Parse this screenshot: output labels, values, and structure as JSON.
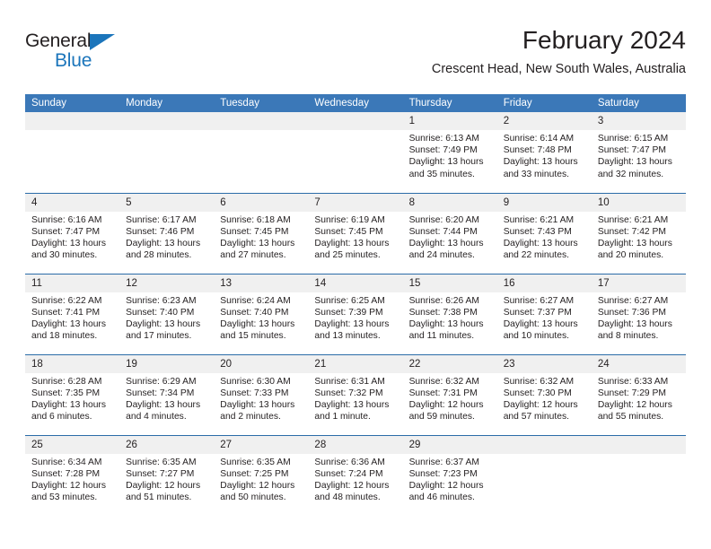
{
  "brand": {
    "name_top": "General",
    "name_bottom": "Blue",
    "triangle_color": "#1b75bb"
  },
  "header": {
    "title": "February 2024",
    "subtitle": "Crescent Head, New South Wales, Australia"
  },
  "colors": {
    "header_blue": "#3b78b8",
    "row_line_blue": "#2b6ca8",
    "daynum_band": "#f0f0f0",
    "text": "#231f20",
    "brand_blue": "#1b75bb"
  },
  "weekdays": [
    "Sunday",
    "Monday",
    "Tuesday",
    "Wednesday",
    "Thursday",
    "Friday",
    "Saturday"
  ],
  "weeks": [
    [
      {
        "day": "",
        "empty": true
      },
      {
        "day": "",
        "empty": true
      },
      {
        "day": "",
        "empty": true
      },
      {
        "day": "",
        "empty": true
      },
      {
        "day": "1",
        "sunrise": "Sunrise: 6:13 AM",
        "sunset": "Sunset: 7:49 PM",
        "daylight": "Daylight: 13 hours and 35 minutes."
      },
      {
        "day": "2",
        "sunrise": "Sunrise: 6:14 AM",
        "sunset": "Sunset: 7:48 PM",
        "daylight": "Daylight: 13 hours and 33 minutes."
      },
      {
        "day": "3",
        "sunrise": "Sunrise: 6:15 AM",
        "sunset": "Sunset: 7:47 PM",
        "daylight": "Daylight: 13 hours and 32 minutes."
      }
    ],
    [
      {
        "day": "4",
        "sunrise": "Sunrise: 6:16 AM",
        "sunset": "Sunset: 7:47 PM",
        "daylight": "Daylight: 13 hours and 30 minutes."
      },
      {
        "day": "5",
        "sunrise": "Sunrise: 6:17 AM",
        "sunset": "Sunset: 7:46 PM",
        "daylight": "Daylight: 13 hours and 28 minutes."
      },
      {
        "day": "6",
        "sunrise": "Sunrise: 6:18 AM",
        "sunset": "Sunset: 7:45 PM",
        "daylight": "Daylight: 13 hours and 27 minutes."
      },
      {
        "day": "7",
        "sunrise": "Sunrise: 6:19 AM",
        "sunset": "Sunset: 7:45 PM",
        "daylight": "Daylight: 13 hours and 25 minutes."
      },
      {
        "day": "8",
        "sunrise": "Sunrise: 6:20 AM",
        "sunset": "Sunset: 7:44 PM",
        "daylight": "Daylight: 13 hours and 24 minutes."
      },
      {
        "day": "9",
        "sunrise": "Sunrise: 6:21 AM",
        "sunset": "Sunset: 7:43 PM",
        "daylight": "Daylight: 13 hours and 22 minutes."
      },
      {
        "day": "10",
        "sunrise": "Sunrise: 6:21 AM",
        "sunset": "Sunset: 7:42 PM",
        "daylight": "Daylight: 13 hours and 20 minutes."
      }
    ],
    [
      {
        "day": "11",
        "sunrise": "Sunrise: 6:22 AM",
        "sunset": "Sunset: 7:41 PM",
        "daylight": "Daylight: 13 hours and 18 minutes."
      },
      {
        "day": "12",
        "sunrise": "Sunrise: 6:23 AM",
        "sunset": "Sunset: 7:40 PM",
        "daylight": "Daylight: 13 hours and 17 minutes."
      },
      {
        "day": "13",
        "sunrise": "Sunrise: 6:24 AM",
        "sunset": "Sunset: 7:40 PM",
        "daylight": "Daylight: 13 hours and 15 minutes."
      },
      {
        "day": "14",
        "sunrise": "Sunrise: 6:25 AM",
        "sunset": "Sunset: 7:39 PM",
        "daylight": "Daylight: 13 hours and 13 minutes."
      },
      {
        "day": "15",
        "sunrise": "Sunrise: 6:26 AM",
        "sunset": "Sunset: 7:38 PM",
        "daylight": "Daylight: 13 hours and 11 minutes."
      },
      {
        "day": "16",
        "sunrise": "Sunrise: 6:27 AM",
        "sunset": "Sunset: 7:37 PM",
        "daylight": "Daylight: 13 hours and 10 minutes."
      },
      {
        "day": "17",
        "sunrise": "Sunrise: 6:27 AM",
        "sunset": "Sunset: 7:36 PM",
        "daylight": "Daylight: 13 hours and 8 minutes."
      }
    ],
    [
      {
        "day": "18",
        "sunrise": "Sunrise: 6:28 AM",
        "sunset": "Sunset: 7:35 PM",
        "daylight": "Daylight: 13 hours and 6 minutes."
      },
      {
        "day": "19",
        "sunrise": "Sunrise: 6:29 AM",
        "sunset": "Sunset: 7:34 PM",
        "daylight": "Daylight: 13 hours and 4 minutes."
      },
      {
        "day": "20",
        "sunrise": "Sunrise: 6:30 AM",
        "sunset": "Sunset: 7:33 PM",
        "daylight": "Daylight: 13 hours and 2 minutes."
      },
      {
        "day": "21",
        "sunrise": "Sunrise: 6:31 AM",
        "sunset": "Sunset: 7:32 PM",
        "daylight": "Daylight: 13 hours and 1 minute."
      },
      {
        "day": "22",
        "sunrise": "Sunrise: 6:32 AM",
        "sunset": "Sunset: 7:31 PM",
        "daylight": "Daylight: 12 hours and 59 minutes."
      },
      {
        "day": "23",
        "sunrise": "Sunrise: 6:32 AM",
        "sunset": "Sunset: 7:30 PM",
        "daylight": "Daylight: 12 hours and 57 minutes."
      },
      {
        "day": "24",
        "sunrise": "Sunrise: 6:33 AM",
        "sunset": "Sunset: 7:29 PM",
        "daylight": "Daylight: 12 hours and 55 minutes."
      }
    ],
    [
      {
        "day": "25",
        "sunrise": "Sunrise: 6:34 AM",
        "sunset": "Sunset: 7:28 PM",
        "daylight": "Daylight: 12 hours and 53 minutes."
      },
      {
        "day": "26",
        "sunrise": "Sunrise: 6:35 AM",
        "sunset": "Sunset: 7:27 PM",
        "daylight": "Daylight: 12 hours and 51 minutes."
      },
      {
        "day": "27",
        "sunrise": "Sunrise: 6:35 AM",
        "sunset": "Sunset: 7:25 PM",
        "daylight": "Daylight: 12 hours and 50 minutes."
      },
      {
        "day": "28",
        "sunrise": "Sunrise: 6:36 AM",
        "sunset": "Sunset: 7:24 PM",
        "daylight": "Daylight: 12 hours and 48 minutes."
      },
      {
        "day": "29",
        "sunrise": "Sunrise: 6:37 AM",
        "sunset": "Sunset: 7:23 PM",
        "daylight": "Daylight: 12 hours and 46 minutes."
      },
      {
        "day": "",
        "empty": true
      },
      {
        "day": "",
        "empty": true
      }
    ]
  ]
}
